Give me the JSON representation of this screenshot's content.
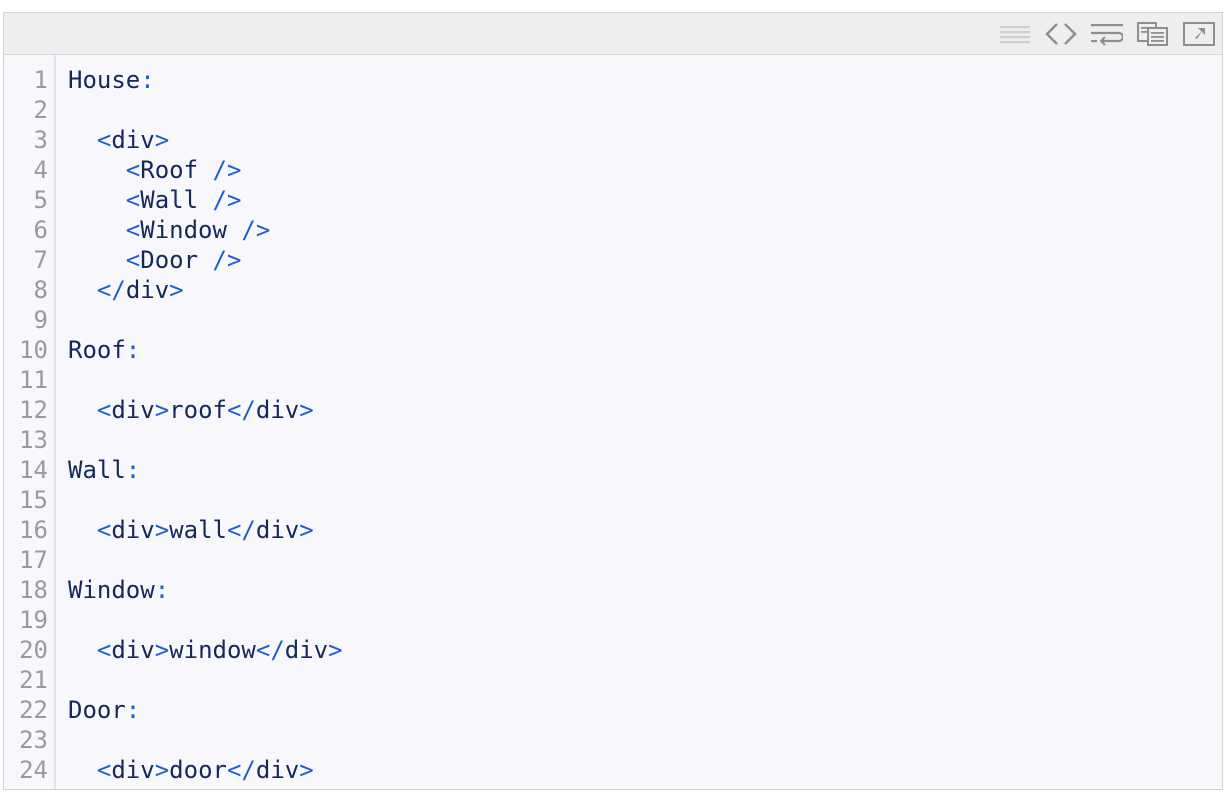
{
  "toolbar": {
    "icons": [
      "view-source-icon",
      "code-icon",
      "wrap-icon",
      "copy-icon",
      "popout-icon"
    ]
  },
  "lines": [
    {
      "n": "1",
      "segments": [
        {
          "t": "House",
          "c": "name"
        },
        {
          "t": ":",
          "c": "sym"
        }
      ]
    },
    {
      "n": "2",
      "segments": []
    },
    {
      "n": "3",
      "segments": [
        {
          "t": "  ",
          "c": "plain"
        },
        {
          "t": "<",
          "c": "tag"
        },
        {
          "t": "div",
          "c": "name"
        },
        {
          "t": ">",
          "c": "tag"
        }
      ]
    },
    {
      "n": "4",
      "segments": [
        {
          "t": "    ",
          "c": "plain"
        },
        {
          "t": "<",
          "c": "tag"
        },
        {
          "t": "Roof",
          "c": "name"
        },
        {
          "t": " />",
          "c": "tag"
        }
      ]
    },
    {
      "n": "5",
      "segments": [
        {
          "t": "    ",
          "c": "plain"
        },
        {
          "t": "<",
          "c": "tag"
        },
        {
          "t": "Wall",
          "c": "name"
        },
        {
          "t": " />",
          "c": "tag"
        }
      ]
    },
    {
      "n": "6",
      "segments": [
        {
          "t": "    ",
          "c": "plain"
        },
        {
          "t": "<",
          "c": "tag"
        },
        {
          "t": "Window",
          "c": "name"
        },
        {
          "t": " />",
          "c": "tag"
        }
      ]
    },
    {
      "n": "7",
      "segments": [
        {
          "t": "    ",
          "c": "plain"
        },
        {
          "t": "<",
          "c": "tag"
        },
        {
          "t": "Door",
          "c": "name"
        },
        {
          "t": " />",
          "c": "tag"
        }
      ]
    },
    {
      "n": "8",
      "segments": [
        {
          "t": "  ",
          "c": "plain"
        },
        {
          "t": "</",
          "c": "tag"
        },
        {
          "t": "div",
          "c": "name"
        },
        {
          "t": ">",
          "c": "tag"
        }
      ]
    },
    {
      "n": "9",
      "segments": []
    },
    {
      "n": "10",
      "segments": [
        {
          "t": "Roof",
          "c": "name"
        },
        {
          "t": ":",
          "c": "sym"
        }
      ]
    },
    {
      "n": "11",
      "segments": []
    },
    {
      "n": "12",
      "segments": [
        {
          "t": "  ",
          "c": "plain"
        },
        {
          "t": "<",
          "c": "tag"
        },
        {
          "t": "div",
          "c": "name"
        },
        {
          "t": ">",
          "c": "tag"
        },
        {
          "t": "roof",
          "c": "plain"
        },
        {
          "t": "</",
          "c": "tag"
        },
        {
          "t": "div",
          "c": "name"
        },
        {
          "t": ">",
          "c": "tag"
        }
      ]
    },
    {
      "n": "13",
      "segments": []
    },
    {
      "n": "14",
      "segments": [
        {
          "t": "Wall",
          "c": "name"
        },
        {
          "t": ":",
          "c": "sym"
        }
      ]
    },
    {
      "n": "15",
      "segments": []
    },
    {
      "n": "16",
      "segments": [
        {
          "t": "  ",
          "c": "plain"
        },
        {
          "t": "<",
          "c": "tag"
        },
        {
          "t": "div",
          "c": "name"
        },
        {
          "t": ">",
          "c": "tag"
        },
        {
          "t": "wall",
          "c": "plain"
        },
        {
          "t": "</",
          "c": "tag"
        },
        {
          "t": "div",
          "c": "name"
        },
        {
          "t": ">",
          "c": "tag"
        }
      ]
    },
    {
      "n": "17",
      "segments": []
    },
    {
      "n": "18",
      "segments": [
        {
          "t": "Window",
          "c": "name"
        },
        {
          "t": ":",
          "c": "sym"
        }
      ]
    },
    {
      "n": "19",
      "segments": []
    },
    {
      "n": "20",
      "segments": [
        {
          "t": "  ",
          "c": "plain"
        },
        {
          "t": "<",
          "c": "tag"
        },
        {
          "t": "div",
          "c": "name"
        },
        {
          "t": ">",
          "c": "tag"
        },
        {
          "t": "window",
          "c": "plain"
        },
        {
          "t": "</",
          "c": "tag"
        },
        {
          "t": "div",
          "c": "name"
        },
        {
          "t": ">",
          "c": "tag"
        }
      ]
    },
    {
      "n": "21",
      "segments": []
    },
    {
      "n": "22",
      "segments": [
        {
          "t": "Door",
          "c": "name"
        },
        {
          "t": ":",
          "c": "sym"
        }
      ]
    },
    {
      "n": "23",
      "segments": []
    },
    {
      "n": "24",
      "segments": [
        {
          "t": "  ",
          "c": "plain"
        },
        {
          "t": "<",
          "c": "tag"
        },
        {
          "t": "div",
          "c": "name"
        },
        {
          "t": ">",
          "c": "tag"
        },
        {
          "t": "door",
          "c": "plain"
        },
        {
          "t": "</",
          "c": "tag"
        },
        {
          "t": "div",
          "c": "name"
        },
        {
          "t": ">",
          "c": "tag"
        }
      ]
    }
  ],
  "colors": {
    "tag": "#1f5fcc",
    "name": "#14285a",
    "line_number": "#9a9a9a",
    "background": "#f8f8fc",
    "toolbar": "#eeeeee"
  }
}
